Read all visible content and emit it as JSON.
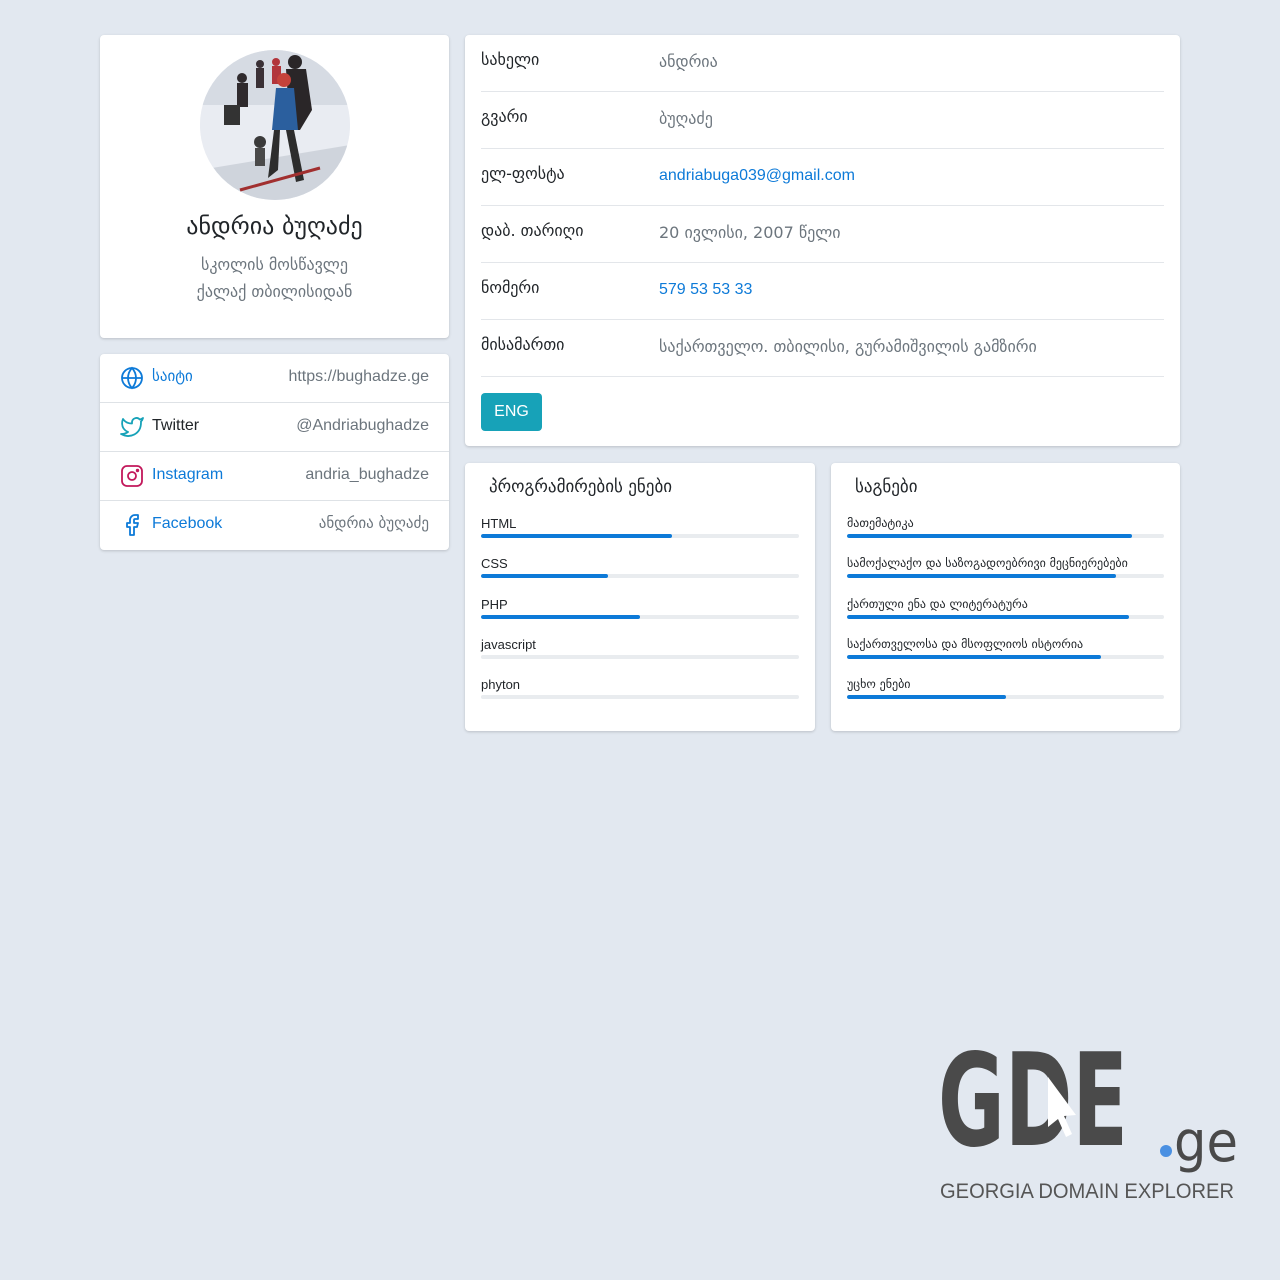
{
  "profile": {
    "name": "ანდრია ბუღაძე",
    "subtitle_1": "სკოლის მოსწავლე",
    "subtitle_2": "ქალაქ თბილისიდან"
  },
  "social": [
    {
      "icon": "globe-icon",
      "label": "საიტი",
      "value": "https://bughadze.ge"
    },
    {
      "icon": "twitter-icon",
      "label": "Twitter",
      "value": "@Andriabughadze"
    },
    {
      "icon": "instagram-icon",
      "label": "Instagram",
      "value": "andria_bughadze"
    },
    {
      "icon": "facebook-icon",
      "label": "Facebook",
      "value": "ანდრია ბუღაძე"
    }
  ],
  "info": [
    {
      "label": "სახელი",
      "value": "ანდრია"
    },
    {
      "label": "გვარი",
      "value": "ბუღაძე"
    },
    {
      "label": "ელ-ფოსტა",
      "value": "andriabuga039@gmail.com"
    },
    {
      "label": "დაბ. თარიღი",
      "value": "20 ივლისი, 2007 წელი"
    },
    {
      "label": "ნომერი",
      "value": "579 53 53 33"
    },
    {
      "label": "მისამართი",
      "value": "საქართველო. თბილისი, გურამიშვილის გამზირი"
    }
  ],
  "language_button": "ENG",
  "programming": {
    "title": "პროგრამირების ენები",
    "items": [
      {
        "name": "HTML",
        "level": 0.6
      },
      {
        "name": "CSS",
        "level": 0.4
      },
      {
        "name": "PHP",
        "level": 0.5
      },
      {
        "name": "javascript",
        "level": 0
      },
      {
        "name": "phyton",
        "level": 0
      }
    ]
  },
  "subjects": {
    "title": "საგნები",
    "items": [
      {
        "name": "მათემატიკა",
        "level": 0.9
      },
      {
        "name": "სამოქალაქო და საზოგადოებრივი მეცნიერებები",
        "level": 0.85
      },
      {
        "name": "ქართული ენა და ლიტერატურა",
        "level": 0.89
      },
      {
        "name": "საქართველოსა და მსოფლიოს ისტორია",
        "level": 0.8
      },
      {
        "name": "უცხო ენები",
        "level": 0.5
      }
    ]
  },
  "colors": {
    "accent": "#0d7ad8",
    "button": "#17a2b8",
    "background": "#e2e8f0"
  },
  "watermark": {
    "logo_text": "GDE.ge",
    "tagline": "GEORGIA DOMAIN EXPLORER"
  }
}
